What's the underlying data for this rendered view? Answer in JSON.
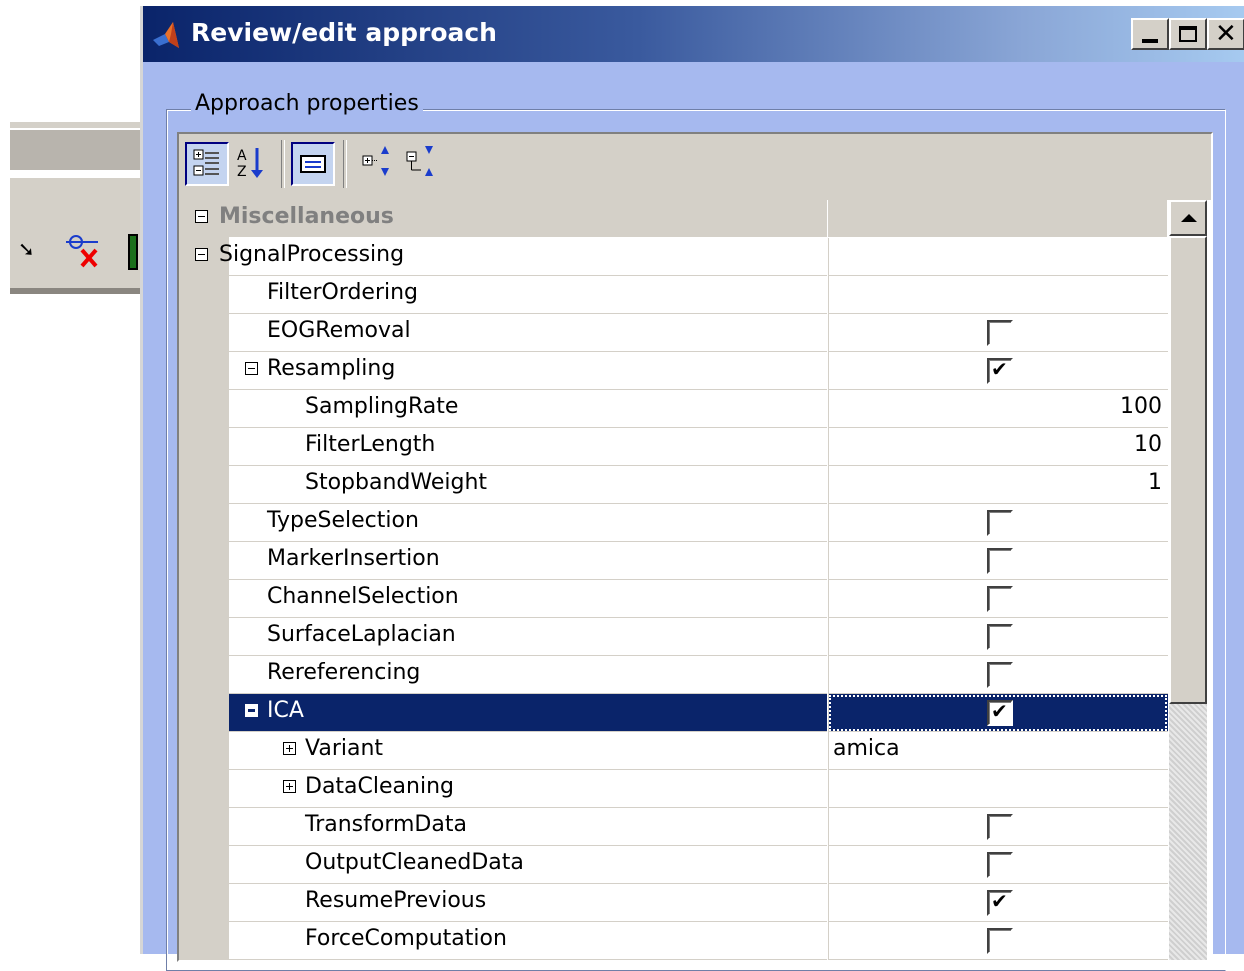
{
  "dialog": {
    "title": "Review/edit approach",
    "group_label": "Approach properties"
  },
  "toolbar": {
    "buttons": [
      {
        "icon": "categorized-view-icon",
        "pressed": true
      },
      {
        "icon": "sort-alphabetical-icon",
        "pressed": false
      },
      {
        "icon": "description-panel-icon",
        "pressed": true
      },
      {
        "icon": "expand-all-icon",
        "pressed": false
      },
      {
        "icon": "collapse-all-icon",
        "pressed": false
      }
    ]
  },
  "properties": {
    "rows": [
      {
        "label": "Miscellaneous",
        "level": 0,
        "type": "category",
        "toggle": "minus",
        "value_type": "none"
      },
      {
        "label": "SignalProcessing",
        "level": 0,
        "toggle": "minus",
        "value_type": "none"
      },
      {
        "label": "FilterOrdering",
        "level": 1,
        "value_type": "none"
      },
      {
        "label": "EOGRemoval",
        "level": 1,
        "value_type": "checkbox",
        "checked": false
      },
      {
        "label": "Resampling",
        "level": 1,
        "toggle": "minus",
        "value_type": "checkbox",
        "checked": true
      },
      {
        "label": "SamplingRate",
        "level": 2,
        "value_type": "number",
        "value": "100"
      },
      {
        "label": "FilterLength",
        "level": 2,
        "value_type": "number",
        "value": "10"
      },
      {
        "label": "StopbandWeight",
        "level": 2,
        "value_type": "number",
        "value": "1"
      },
      {
        "label": "TypeSelection",
        "level": 1,
        "value_type": "checkbox",
        "checked": false
      },
      {
        "label": "MarkerInsertion",
        "level": 1,
        "value_type": "checkbox",
        "checked": false
      },
      {
        "label": "ChannelSelection",
        "level": 1,
        "value_type": "checkbox",
        "checked": false
      },
      {
        "label": "SurfaceLaplacian",
        "level": 1,
        "value_type": "checkbox",
        "checked": false
      },
      {
        "label": "Rereferencing",
        "level": 1,
        "value_type": "checkbox",
        "checked": false
      },
      {
        "label": "ICA",
        "level": 1,
        "toggle": "minus",
        "value_type": "checkbox",
        "checked": true,
        "selected": true
      },
      {
        "label": "Variant",
        "level": 2,
        "toggle": "plus",
        "value_type": "text",
        "value": "amica"
      },
      {
        "label": "DataCleaning",
        "level": 2,
        "toggle": "plus",
        "value_type": "none"
      },
      {
        "label": "TransformData",
        "level": 2,
        "value_type": "checkbox",
        "checked": false
      },
      {
        "label": "OutputCleanedData",
        "level": 2,
        "value_type": "checkbox",
        "checked": false
      },
      {
        "label": "ResumePrevious",
        "level": 2,
        "value_type": "checkbox",
        "checked": true
      },
      {
        "label": "ForceComputation",
        "level": 2,
        "value_type": "checkbox",
        "checked": false
      },
      {
        "label": "",
        "level": 2,
        "value_type": "checkbox",
        "checked": false
      }
    ]
  },
  "colors": {
    "title_gradient_start": "#0a246a",
    "dialog_background": "#a6b9ef",
    "selection": "#0a246a",
    "category_text": "#808080"
  }
}
